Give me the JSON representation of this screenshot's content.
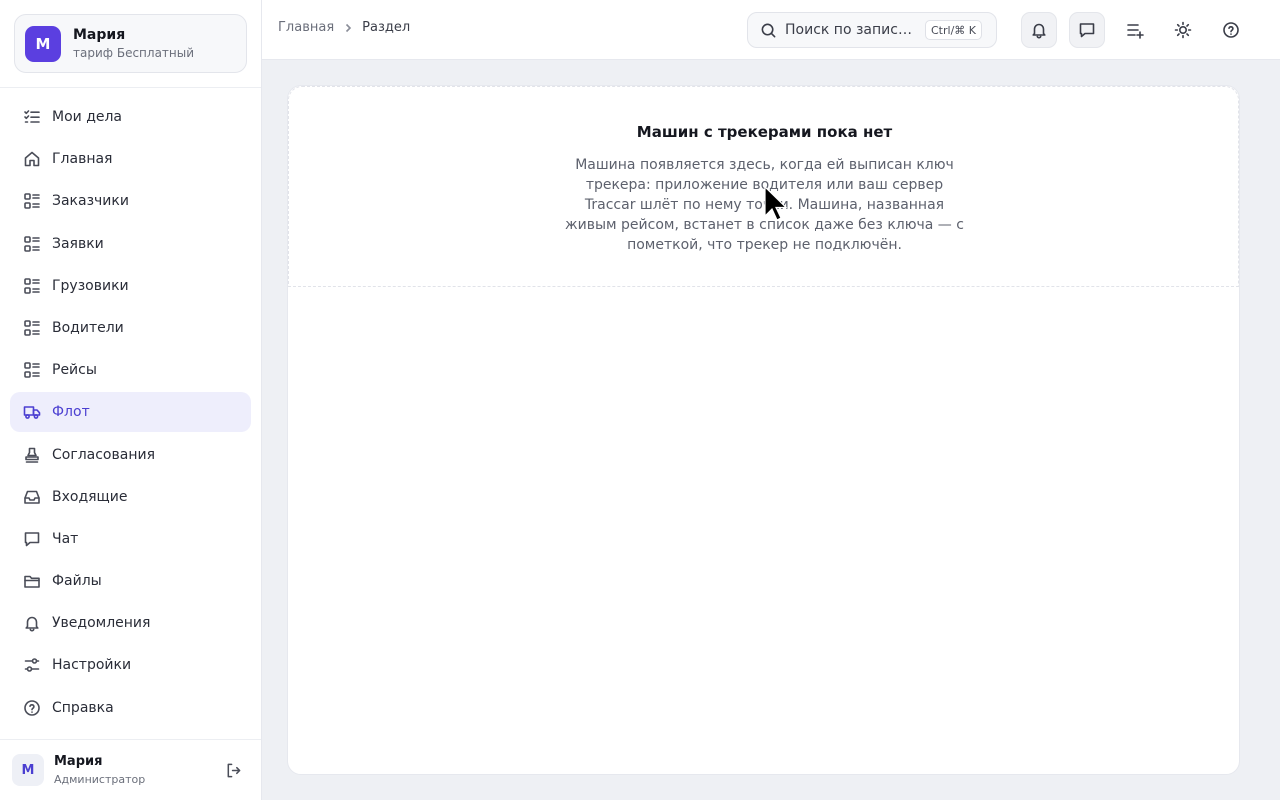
{
  "account": {
    "avatar_letter": "М",
    "name": "Мария",
    "plan": "тариф Бесплатный",
    "avatar_color": "#5b3fe0"
  },
  "nav": {
    "items": [
      {
        "label": "Мои дела",
        "icon": "checklist-icon"
      },
      {
        "label": "Главная",
        "icon": "home-icon"
      },
      {
        "label": "Заказчики",
        "icon": "list-icon"
      },
      {
        "label": "Заявки",
        "icon": "list-icon"
      },
      {
        "label": "Грузовики",
        "icon": "list-icon"
      },
      {
        "label": "Водители",
        "icon": "list-icon"
      },
      {
        "label": "Рейсы",
        "icon": "list-icon"
      },
      {
        "label": "Флот",
        "icon": "truck-icon",
        "active": true
      },
      {
        "label": "Согласования",
        "icon": "stamp-icon"
      },
      {
        "label": "Входящие",
        "icon": "inbox-icon"
      },
      {
        "label": "Чат",
        "icon": "chat-icon"
      },
      {
        "label": "Файлы",
        "icon": "folder-icon"
      },
      {
        "label": "Уведомления",
        "icon": "bell-icon"
      },
      {
        "label": "Настройки",
        "icon": "sliders-icon"
      },
      {
        "label": "Справка",
        "icon": "help-icon"
      }
    ]
  },
  "user": {
    "avatar_letter": "М",
    "name": "Мария",
    "role": "Администратор"
  },
  "breadcrumb": {
    "home": "Главная",
    "current": "Раздел"
  },
  "search": {
    "placeholder": "Поиск по записям",
    "shortcut": "Ctrl/⌘ K"
  },
  "empty_state": {
    "title": "Машин с трекерами пока нет",
    "text": "Машина появляется здесь, когда ей выписан ключ трекера: приложение водителя или ваш сервер Traccar шлёт по нему точки. Машина, названная живым рейсом, встанет в список даже без ключа — с пометкой, что трекер не подключён."
  },
  "colors": {
    "accent": "#4b3fd1",
    "active_bg": "#eeeefc",
    "page_bg": "#eef0f4"
  }
}
